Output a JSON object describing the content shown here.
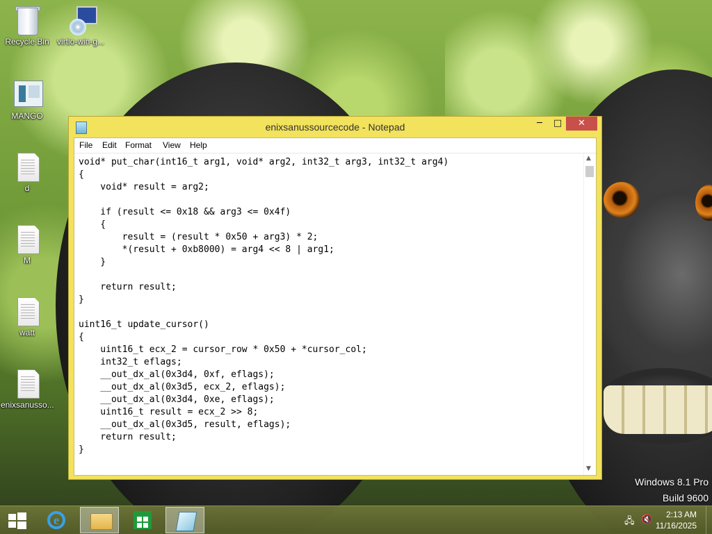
{
  "desktop": {
    "icons": [
      {
        "label": "Recycle Bin",
        "icon": "recycle-bin-icon"
      },
      {
        "label": "virtio-win-g...",
        "icon": "installer-icon"
      },
      {
        "label": "MANGO",
        "icon": "mango-app-icon"
      },
      {
        "label": "d",
        "icon": "text-document-icon"
      },
      {
        "label": "M",
        "icon": "text-document-icon"
      },
      {
        "label": "watt",
        "icon": "text-document-icon"
      },
      {
        "label": "enixsanusso...",
        "icon": "text-document-icon"
      }
    ]
  },
  "notepad": {
    "title": "enixsanussourcecode - Notepad",
    "controls": {
      "minimize": "─",
      "maximize": "□",
      "close": "✕"
    },
    "menu": [
      "File",
      "Edit",
      "Format",
      "View",
      "Help"
    ],
    "content": "void* put_char(int16_t arg1, void* arg2, int32_t arg3, int32_t arg4)\n{\n    void* result = arg2;\n\n    if (result <= 0x18 && arg3 <= 0x4f)\n    {\n        result = (result * 0x50 + arg3) * 2;\n        *(result + 0xb8000) = arg4 << 8 | arg1;\n    }\n\n    return result;\n}\n\nuint16_t update_cursor()\n{\n    uint16_t ecx_2 = cursor_row * 0x50 + *cursor_col;\n    int32_t eflags;\n    __out_dx_al(0x3d4, 0xf, eflags);\n    __out_dx_al(0x3d5, ecx_2, eflags);\n    __out_dx_al(0x3d4, 0xe, eflags);\n    uint16_t result = ecx_2 >> 8;\n    __out_dx_al(0x3d5, result, eflags);\n    return result;\n}",
    "scroll": {
      "up": "▲",
      "down": "▼"
    }
  },
  "watermark": {
    "line1": "Windows 8.1 Pro",
    "line2": "Build 9600"
  },
  "taskbar": {
    "pinned": [
      {
        "name": "internet-explorer",
        "icon": "internet-explorer-icon",
        "glyph": "e",
        "active": false
      },
      {
        "name": "file-explorer",
        "icon": "folder-icon",
        "active": true
      },
      {
        "name": "store",
        "icon": "store-icon",
        "active": false
      },
      {
        "name": "notepad",
        "icon": "notepad-icon",
        "active": true
      }
    ],
    "tray": {
      "network_icon": "network-icon",
      "network_glyph": "🖧",
      "volume_icon": "volume-muted-icon",
      "volume_glyph": "🔇"
    },
    "clock": {
      "time": "2:13 AM",
      "date": "11/16/2025"
    }
  },
  "colors": {
    "window_frame": "#f2e25c",
    "close_button": "#c7504a",
    "taskbar": "#6e7638"
  }
}
